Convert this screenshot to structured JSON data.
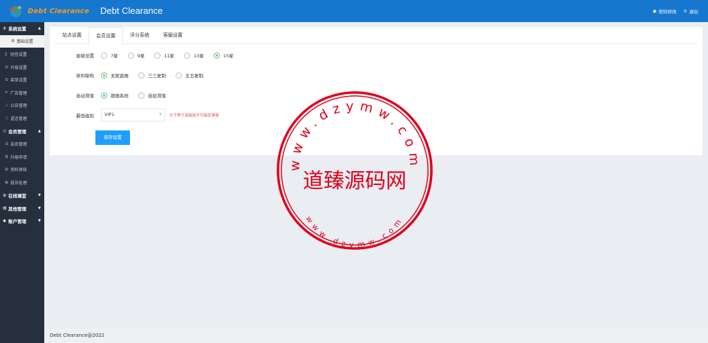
{
  "header": {
    "logo_text": "Debt Clearance",
    "title": "Debt Clearance",
    "links": [
      {
        "icon": "lock-icon",
        "label": "密码修改"
      },
      {
        "icon": "menu-icon",
        "label": "退出"
      }
    ]
  },
  "sidebar": {
    "items": [
      {
        "type": "group",
        "icon": "✣",
        "label": "系统设置",
        "caret": "▲"
      },
      {
        "type": "active",
        "icon": "⚙",
        "label": "基础设置"
      },
      {
        "type": "item",
        "icon": "▯",
        "label": "短信设置"
      },
      {
        "type": "item",
        "icon": "⊙",
        "label": "升级设置"
      },
      {
        "type": "item",
        "icon": "⊙",
        "label": "菜单设置"
      },
      {
        "type": "item",
        "icon": "⟡",
        "label": "广告管理"
      },
      {
        "type": "item",
        "icon": "♤",
        "label": "公告管理"
      },
      {
        "type": "item",
        "icon": "♤",
        "label": "语言管理"
      },
      {
        "type": "group",
        "icon": "⚇",
        "label": "会员管理",
        "caret": "▲"
      },
      {
        "type": "item",
        "icon": "♙",
        "label": "会员管理"
      },
      {
        "type": "item",
        "icon": "⇅",
        "label": "升级申请"
      },
      {
        "type": "item",
        "icon": "⊘",
        "label": "资料审核"
      },
      {
        "type": "item",
        "icon": "⊕",
        "label": "投诉处理"
      },
      {
        "type": "group",
        "icon": "⚙",
        "label": "在线课堂",
        "caret": "▼"
      },
      {
        "type": "group",
        "icon": "▤",
        "label": "其他管理",
        "caret": "▼"
      },
      {
        "type": "group",
        "icon": "✱",
        "label": "账户管理",
        "caret": "▼"
      }
    ]
  },
  "tabs": [
    {
      "label": "站点设置",
      "active": false
    },
    {
      "label": "会员设置",
      "active": true
    },
    {
      "label": "评分系统",
      "active": false
    },
    {
      "label": "客服设置",
      "active": false
    }
  ],
  "form": {
    "star": {
      "label": "星级设置",
      "options": [
        "7星",
        "9星",
        "11星",
        "13星",
        "15星"
      ],
      "selected": 4
    },
    "structure": {
      "label": "排列架构",
      "options": [
        "无限直推",
        "三三复制",
        "五五复制"
      ],
      "selected": 0
    },
    "auto": {
      "label": "自动滑落",
      "options": [
        "跟随系统",
        "自层滑落"
      ],
      "selected": 0
    },
    "level": {
      "label": "最低级别",
      "value": "VIP1",
      "hint": "大于等于该级别才可接受滑落"
    },
    "save_label": "保存设置"
  },
  "stamp": {
    "main_text": "道臻源码网",
    "top_arc": "www.dzymw.com",
    "bottom_arc": "www.dzymw.com",
    "color": "#e0001b"
  },
  "footer": {
    "text": "Debt Clearance@2022"
  },
  "colors": {
    "header": "#1677cf",
    "sidebar": "#262f3e",
    "accent": "#1e9fff",
    "radio": "#5fb878",
    "hint": "#e24a4a"
  }
}
